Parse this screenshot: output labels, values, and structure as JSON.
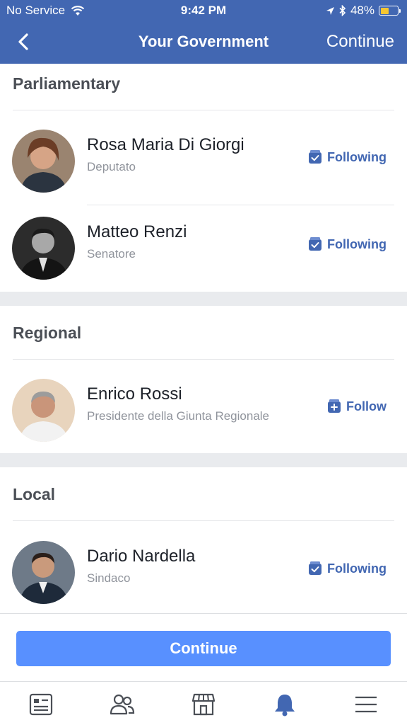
{
  "status": {
    "carrier": "No Service",
    "time": "9:42 PM",
    "battery": "48%",
    "battery_level": 0.48
  },
  "nav": {
    "title": "Your Government",
    "continue_label": "Continue"
  },
  "sections": [
    {
      "title": "Parliamentary",
      "people": [
        {
          "name": "Rosa Maria Di Giorgi",
          "role": "Deputato",
          "action": "Following"
        },
        {
          "name": "Matteo Renzi",
          "role": "Senatore",
          "action": "Following"
        }
      ]
    },
    {
      "title": "Regional",
      "people": [
        {
          "name": "Enrico Rossi",
          "role": "Presidente della Giunta Regionale",
          "action": "Follow"
        }
      ]
    },
    {
      "title": "Local",
      "people": [
        {
          "name": "Dario Nardella",
          "role": "Sindaco",
          "action": "Following"
        }
      ]
    }
  ],
  "cta": {
    "label": "Continue"
  },
  "tabs": [
    "news-feed-icon",
    "friends-icon",
    "marketplace-icon",
    "notifications-icon",
    "menu-icon"
  ],
  "colors": {
    "brand": "#4267b2",
    "cta": "#5890ff",
    "active_tab": "#4267b2",
    "battery": "#f7c631"
  }
}
